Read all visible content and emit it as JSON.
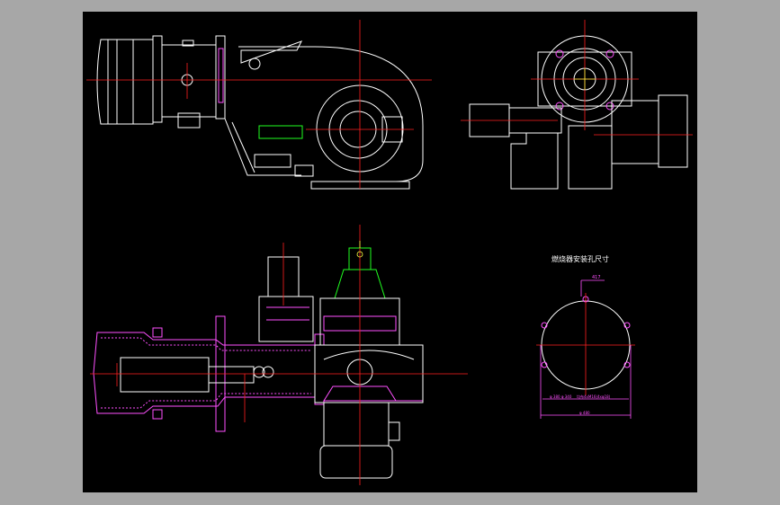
{
  "drawing": {
    "section_title": "燃烧器安装孔尺寸",
    "dimensions": {
      "small_top": "417",
      "bottom_overall": "φ 480",
      "left_small": "φ 380 φ 340",
      "mid_bolt": "均布4xM16(4xφ18)"
    }
  },
  "colors": {
    "background_outer": "#a7a7a7",
    "canvas": "#000000",
    "geometry": "#ffffff",
    "centerline": "#ff2020",
    "section": "#ff50ff",
    "highlight": "#20ff20",
    "accent": "#ffff40"
  }
}
